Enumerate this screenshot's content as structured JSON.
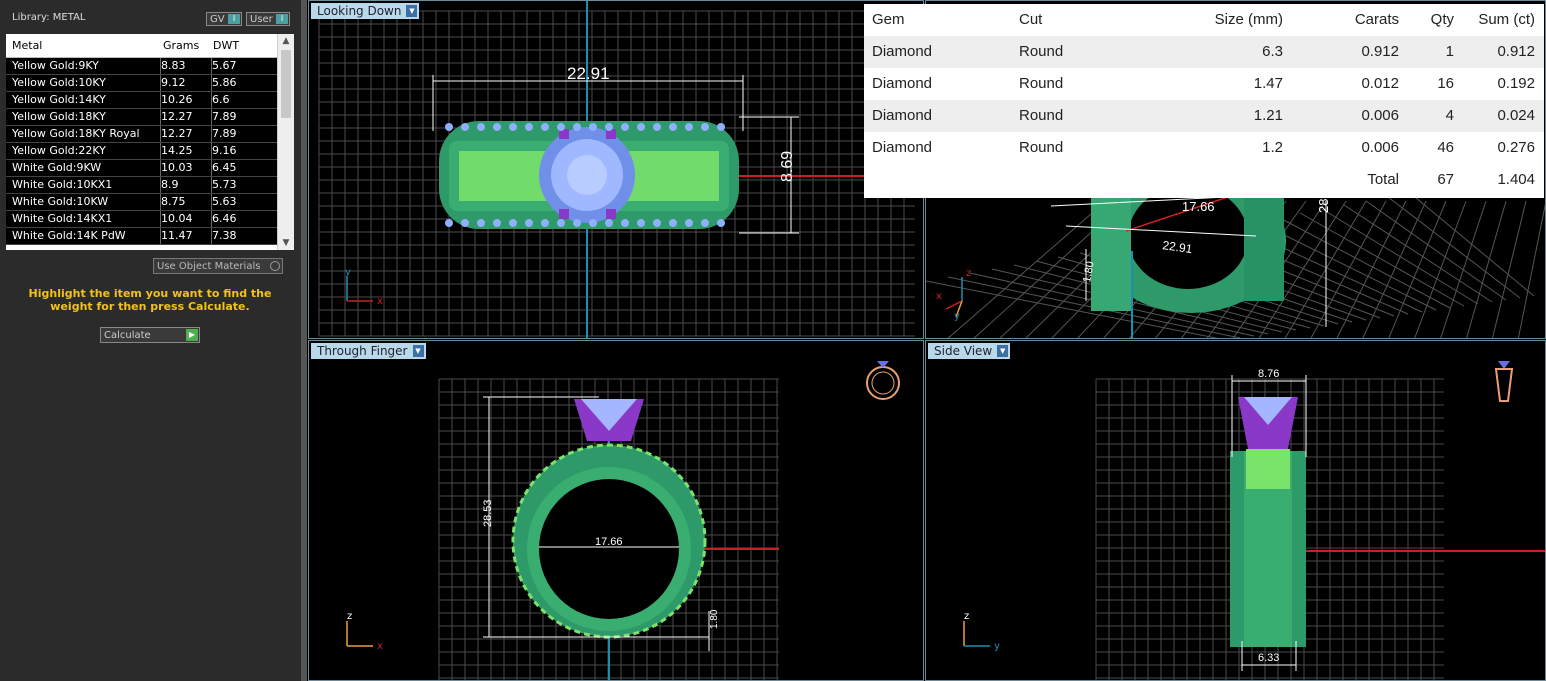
{
  "library": {
    "title": "Library: METAL",
    "toggle_gv": "GV",
    "toggle_user": "User",
    "columns": [
      "Metal",
      "Grams",
      "DWT"
    ],
    "rows": [
      [
        "Yellow Gold:9KY",
        "8.83",
        "5.67"
      ],
      [
        "Yellow Gold:10KY",
        "9.12",
        "5.86"
      ],
      [
        "Yellow Gold:14KY",
        "10.26",
        "6.6"
      ],
      [
        "Yellow Gold:18KY",
        "12.27",
        "7.89"
      ],
      [
        "Yellow Gold:18KY Royal",
        "12.27",
        "7.89"
      ],
      [
        "Yellow Gold:22KY",
        "14.25",
        "9.16"
      ],
      [
        "White Gold:9KW",
        "10.03",
        "6.45"
      ],
      [
        "White Gold:10KX1",
        "8.9",
        "5.73"
      ],
      [
        "White Gold:10KW",
        "8.75",
        "5.63"
      ],
      [
        "White Gold:14KX1",
        "10.04",
        "6.46"
      ],
      [
        "White Gold:14K PdW",
        "11.47",
        "7.38"
      ]
    ],
    "use_object_materials": "Use Object Materials",
    "hint": "Highlight the item you want to find the weight for then press Calculate.",
    "calculate": "Calculate"
  },
  "viewports": {
    "top_left": {
      "label": "Looking Down",
      "dim_width": "22.91",
      "dim_height": "8.69",
      "axis_h": "x",
      "axis_v": "y"
    },
    "top_right": {
      "dim_a": "17.66",
      "dim_b": "22.91",
      "dim_c": "1.80",
      "dim_d": "28",
      "axis_h": "x",
      "axis_v": "z",
      "axis_d": "y"
    },
    "bottom_left": {
      "label": "Through Finger",
      "dim_inner": "17.66",
      "dim_height": "28.53",
      "dim_band": "1.80",
      "axis_h": "x",
      "axis_v": "z"
    },
    "bottom_right": {
      "label": "Side View",
      "dim_top": "8.76",
      "dim_bottom": "6.33",
      "axis_h": "y",
      "axis_v": "z"
    }
  },
  "gems": {
    "headers": [
      "Gem",
      "Cut",
      "Size (mm)",
      "Carats",
      "Qty",
      "Sum (ct)"
    ],
    "rows": [
      [
        "Diamond",
        "Round",
        "6.3",
        "0.912",
        "1",
        "0.912"
      ],
      [
        "Diamond",
        "Round",
        "1.47",
        "0.012",
        "16",
        "0.192"
      ],
      [
        "Diamond",
        "Round",
        "1.21",
        "0.006",
        "4",
        "0.024"
      ],
      [
        "Diamond",
        "Round",
        "1.2",
        "0.006",
        "46",
        "0.276"
      ]
    ],
    "total_label": "Total",
    "total_qty": "67",
    "total_sum": "1.404"
  },
  "colors": {
    "ring_green": "#2e9a6a",
    "ring_light": "#7be36a",
    "gem_blue": "#8fb0ff",
    "prong_purple": "#8a38c8",
    "grid": "#555555",
    "dim_line": "#ffffff",
    "axis_red": "#cc2020",
    "axis_cyan": "#1a8fb0",
    "label_bg": "#b9d9ea",
    "hint_yellow": "#f2c21a"
  }
}
